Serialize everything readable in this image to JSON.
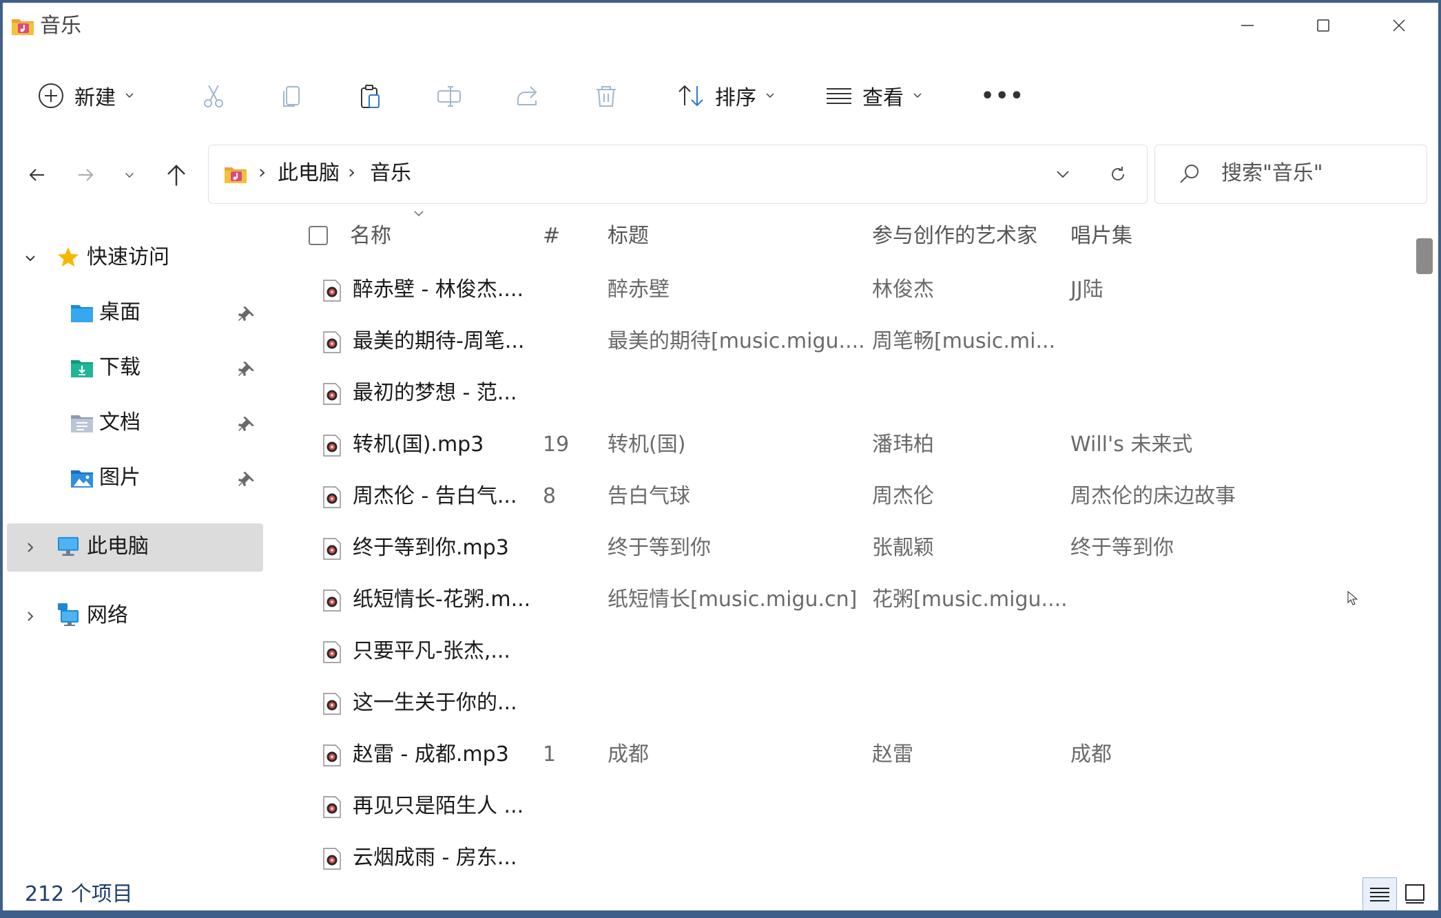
{
  "window": {
    "title": "音乐"
  },
  "toolbar": {
    "new_label": "新建",
    "sort_label": "排序",
    "view_label": "查看",
    "more_label": "•••"
  },
  "address": {
    "crumbs": [
      "此电脑",
      "音乐"
    ],
    "separator": "›"
  },
  "search": {
    "placeholder": "搜索\"音乐\""
  },
  "sidebar": {
    "quick_access": "快速访问",
    "items": [
      {
        "label": "桌面",
        "icon": "desktop-folder-icon"
      },
      {
        "label": "下载",
        "icon": "downloads-folder-icon"
      },
      {
        "label": "文档",
        "icon": "documents-folder-icon"
      },
      {
        "label": "图片",
        "icon": "pictures-folder-icon"
      }
    ],
    "this_pc": "此电脑",
    "network": "网络"
  },
  "columns": {
    "name": "名称",
    "number": "#",
    "title": "标题",
    "artist": "参与创作的艺术家",
    "album": "唱片集"
  },
  "files": [
    {
      "name": "醉赤壁 - 林俊杰....",
      "num": "",
      "title": "醉赤壁",
      "artist": "林俊杰",
      "album": "JJ陆"
    },
    {
      "name": "最美的期待-周笔...",
      "num": "",
      "title": "最美的期待[music.migu....",
      "artist": "周笔畅[music.mi...",
      "album": ""
    },
    {
      "name": "最初的梦想 - 范...",
      "num": "",
      "title": "",
      "artist": "",
      "album": ""
    },
    {
      "name": "转机(国).mp3",
      "num": "19",
      "title": "转机(国)",
      "artist": "潘玮柏",
      "album": "Will's 未来式"
    },
    {
      "name": "周杰伦 - 告白气...",
      "num": "8",
      "title": "告白气球",
      "artist": "周杰伦",
      "album": "周杰伦的床边故事"
    },
    {
      "name": "终于等到你.mp3",
      "num": "",
      "title": "终于等到你",
      "artist": "张靓颖",
      "album": "终于等到你"
    },
    {
      "name": "纸短情长-花粥.m...",
      "num": "",
      "title": "纸短情长[music.migu.cn]",
      "artist": "花粥[music.migu....",
      "album": ""
    },
    {
      "name": "只要平凡-张杰,...",
      "num": "",
      "title": "",
      "artist": "",
      "album": ""
    },
    {
      "name": "这一生关于你的...",
      "num": "",
      "title": "",
      "artist": "",
      "album": ""
    },
    {
      "name": "赵雷 - 成都.mp3",
      "num": "1",
      "title": "成都",
      "artist": "赵雷",
      "album": "成都"
    },
    {
      "name": "再见只是陌生人 ...",
      "num": "",
      "title": "",
      "artist": "",
      "album": ""
    },
    {
      "name": "云烟成雨 - 房东...",
      "num": "",
      "title": "",
      "artist": "",
      "album": ""
    }
  ],
  "status": {
    "item_count": "212 个项目"
  },
  "colors": {
    "accent": "#0067c0",
    "selected_bg": "#dcdcdc",
    "folder_yellow": "#f3c13a"
  }
}
